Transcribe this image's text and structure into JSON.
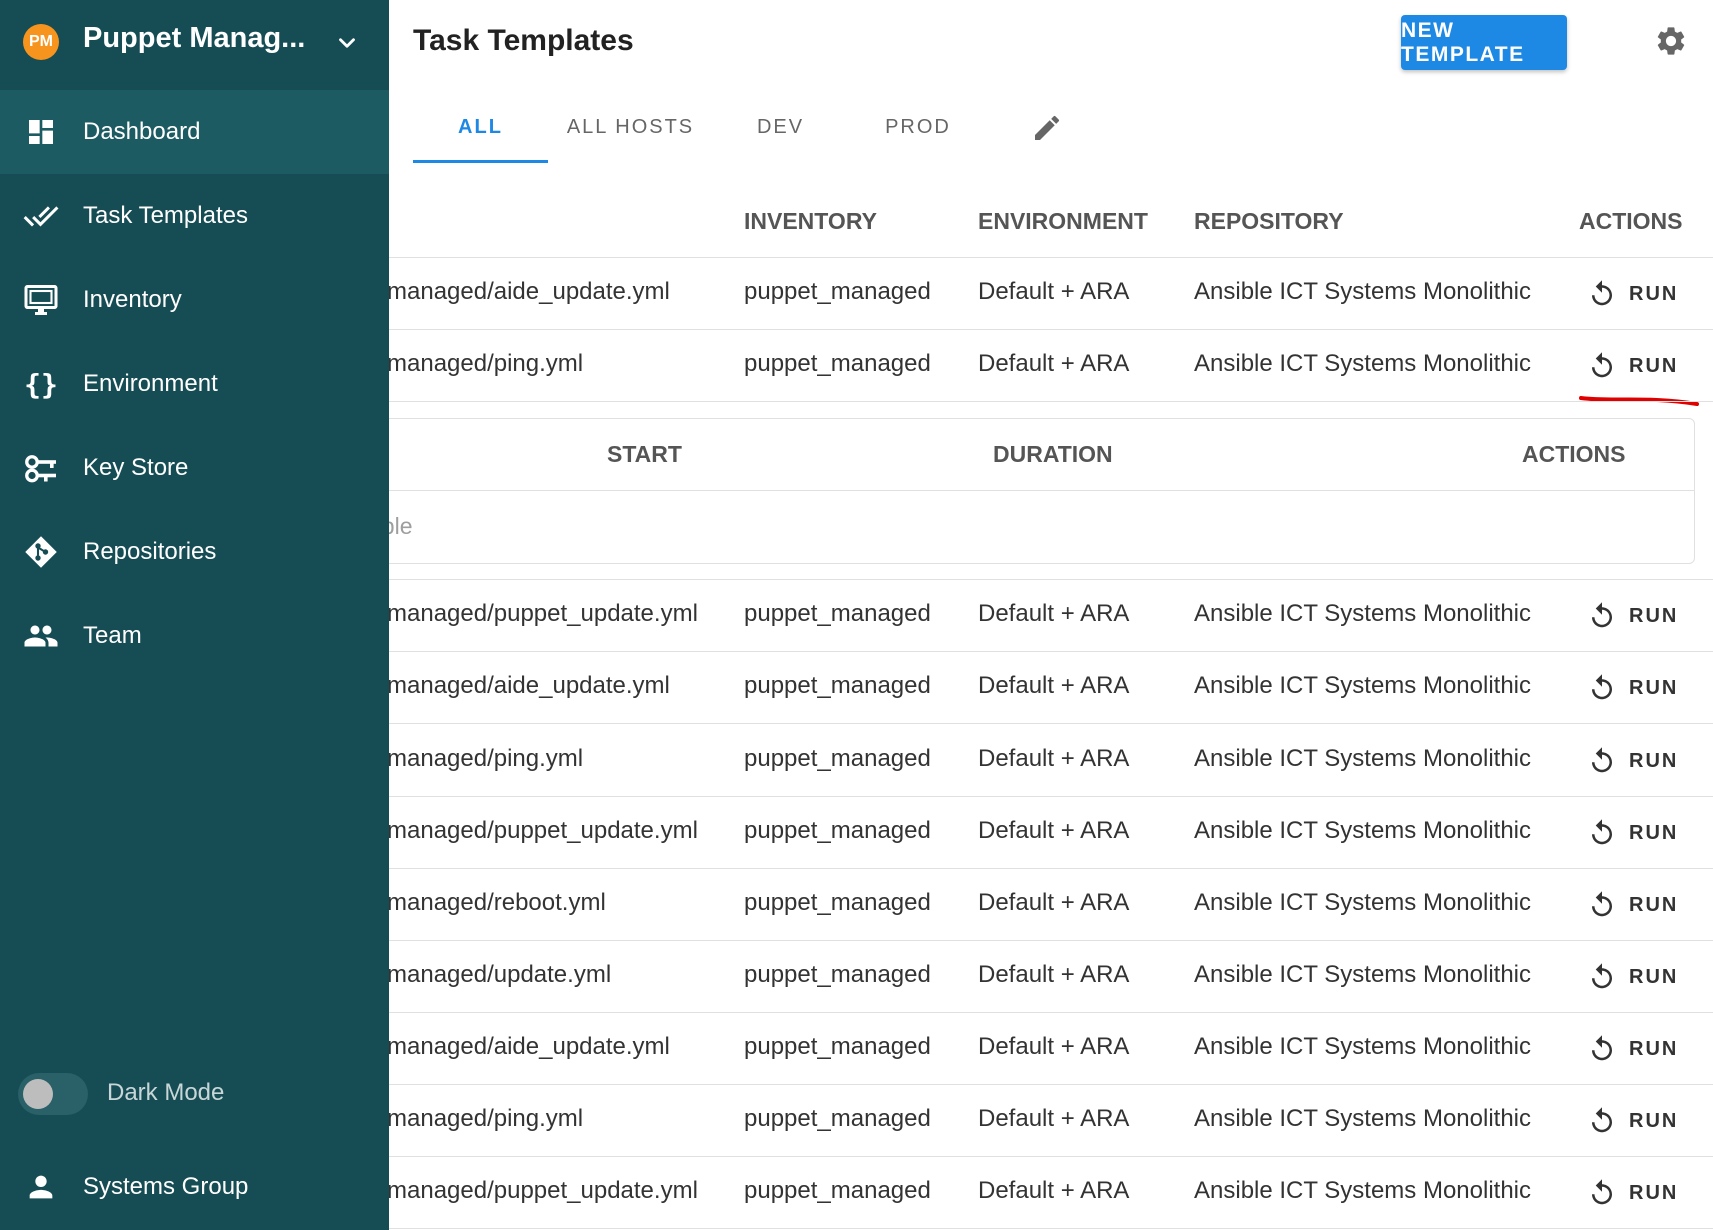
{
  "sidebar": {
    "avatar_initials": "PM",
    "project_name": "Puppet Manag...",
    "items": [
      {
        "label": "Dashboard",
        "icon": "dashboard-icon"
      },
      {
        "label": "Task Templates",
        "icon": "double-check-icon"
      },
      {
        "label": "Inventory",
        "icon": "monitor-icon"
      },
      {
        "label": "Environment",
        "icon": "braces-icon"
      },
      {
        "label": "Key Store",
        "icon": "key-icon"
      },
      {
        "label": "Repositories",
        "icon": "git-icon"
      },
      {
        "label": "Team",
        "icon": "team-icon"
      }
    ],
    "dark_mode_label": "Dark Mode",
    "user_label": "Systems Group"
  },
  "header": {
    "title": "Task Templates",
    "new_button_label": "NEW TEMPLATE"
  },
  "tabs": [
    "ALL",
    "ALL HOSTS",
    "DEV",
    "PROD"
  ],
  "table": {
    "columns": [
      "INVENTORY",
      "ENVIRONMENT",
      "REPOSITORY",
      "ACTIONS"
    ],
    "run_label": "RUN",
    "rows": [
      {
        "playbook": "managed/aide_update.yml",
        "inventory": "puppet_managed",
        "environment": "Default + ARA",
        "repository": "Ansible ICT Systems Monolithic"
      },
      {
        "playbook": "managed/ping.yml",
        "inventory": "puppet_managed",
        "environment": "Default + ARA",
        "repository": "Ansible ICT Systems Monolithic"
      },
      {
        "playbook": "managed/puppet_update.yml",
        "inventory": "puppet_managed",
        "environment": "Default + ARA",
        "repository": "Ansible ICT Systems Monolithic"
      },
      {
        "playbook": "managed/aide_update.yml",
        "inventory": "puppet_managed",
        "environment": "Default + ARA",
        "repository": "Ansible ICT Systems Monolithic"
      },
      {
        "playbook": "managed/ping.yml",
        "inventory": "puppet_managed",
        "environment": "Default + ARA",
        "repository": "Ansible ICT Systems Monolithic"
      },
      {
        "playbook": "managed/puppet_update.yml",
        "inventory": "puppet_managed",
        "environment": "Default + ARA",
        "repository": "Ansible ICT Systems Monolithic"
      },
      {
        "playbook": "managed/reboot.yml",
        "inventory": "puppet_managed",
        "environment": "Default + ARA",
        "repository": "Ansible ICT Systems Monolithic"
      },
      {
        "playbook": "managed/update.yml",
        "inventory": "puppet_managed",
        "environment": "Default + ARA",
        "repository": "Ansible ICT Systems Monolithic"
      },
      {
        "playbook": "managed/aide_update.yml",
        "inventory": "puppet_managed",
        "environment": "Default + ARA",
        "repository": "Ansible ICT Systems Monolithic"
      },
      {
        "playbook": "managed/ping.yml",
        "inventory": "puppet_managed",
        "environment": "Default + ARA",
        "repository": "Ansible ICT Systems Monolithic"
      },
      {
        "playbook": "managed/puppet_update.yml",
        "inventory": "puppet_managed",
        "environment": "Default + ARA",
        "repository": "Ansible ICT Systems Monolithic"
      }
    ]
  },
  "expanded": {
    "columns": [
      "START",
      "DURATION",
      "ACTIONS"
    ],
    "empty_text": "able"
  },
  "annotation": {
    "mark": "?",
    "color": "#e00000"
  }
}
